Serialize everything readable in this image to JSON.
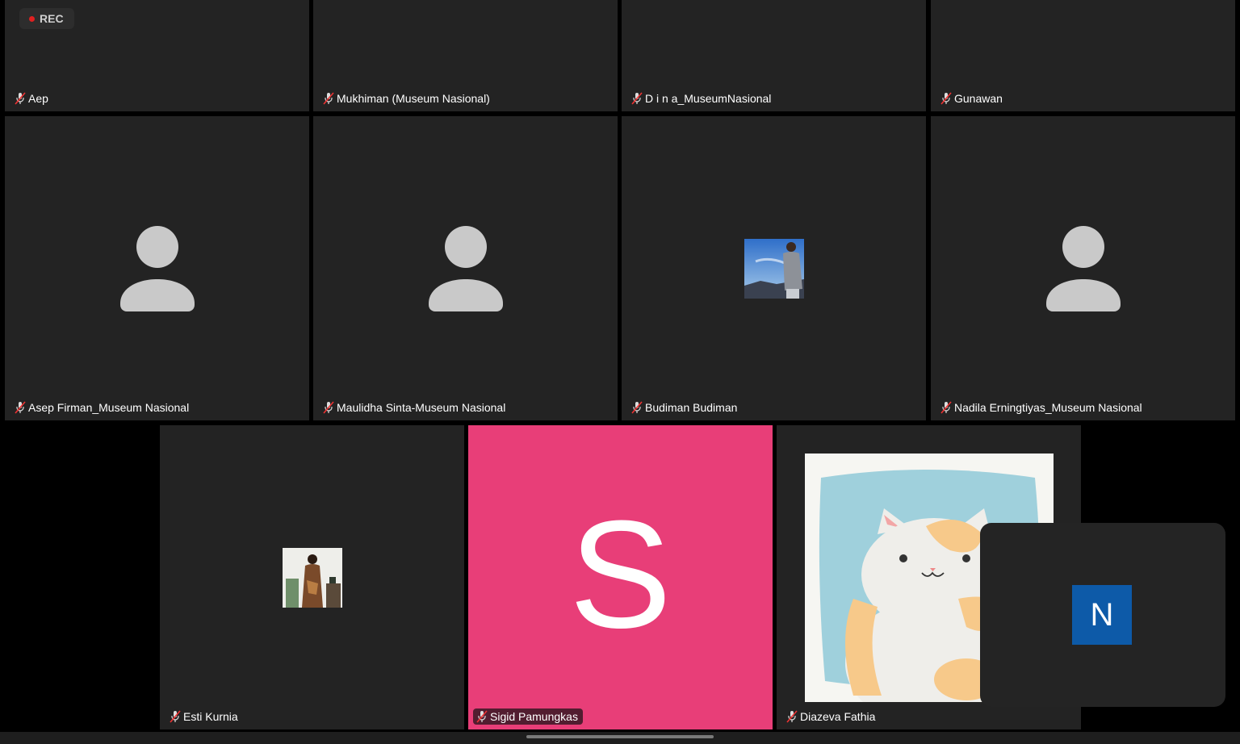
{
  "recording": {
    "label": "REC",
    "dot_color": "#e02020"
  },
  "participants": [
    {
      "name": "Aep"
    },
    {
      "name": "Mukhiman (Museum Nasional)"
    },
    {
      "name": "D i n a_MuseumNasional"
    },
    {
      "name": "Gunawan"
    },
    {
      "name": "Asep Firman_Museum Nasional",
      "avatar": "person-silhouette-icon"
    },
    {
      "name": "Maulidha Sinta-Museum Nasional",
      "avatar": "person-silhouette-icon"
    },
    {
      "name": "Budiman Budiman",
      "avatar": "profile-photo"
    },
    {
      "name": "Nadila Erningtiyas_Museum Nasional",
      "avatar": "person-silhouette-icon"
    },
    {
      "name": "Esti Kurnia",
      "avatar": "profile-photo"
    },
    {
      "name": "Sigid Pamungkas",
      "avatar_letter": "S",
      "tile_color": "#e83e78"
    },
    {
      "name": "Diazeva Fathia",
      "avatar": "cat-illustration"
    }
  ],
  "self_view": {
    "initial": "N",
    "color": "#0d5aa8"
  }
}
